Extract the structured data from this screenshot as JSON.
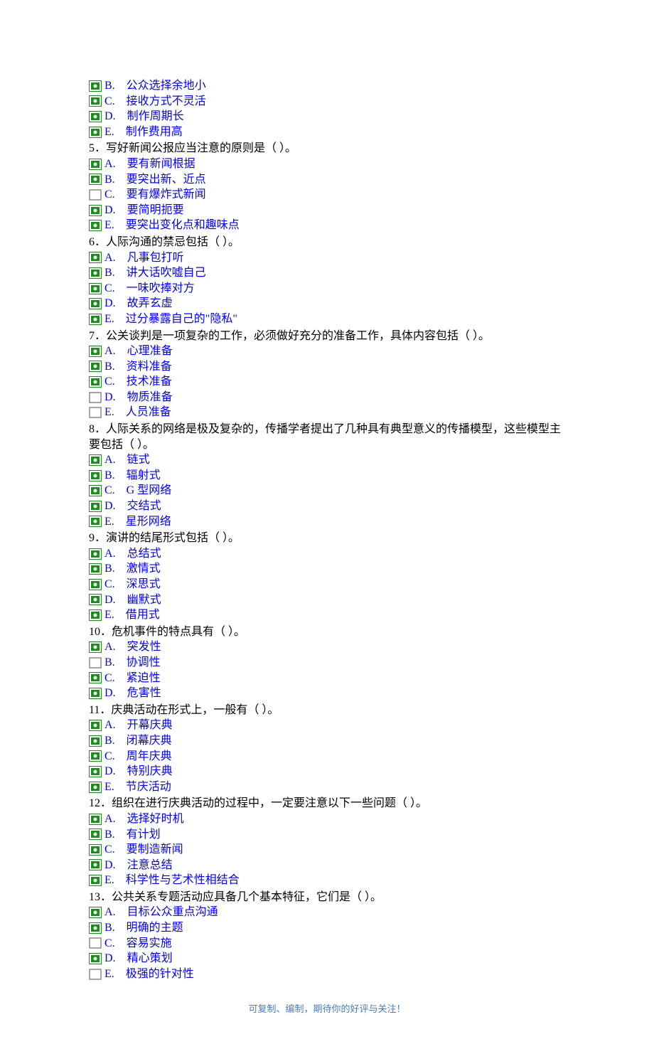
{
  "partial_options": [
    {
      "letter": "B.",
      "text": "公众选择余地小",
      "checked": true
    },
    {
      "letter": "C.",
      "text": "接收方式不灵活",
      "checked": true
    },
    {
      "letter": "D.",
      "text": "制作周期长",
      "checked": true
    },
    {
      "letter": "E.",
      "text": "制作费用高",
      "checked": true
    }
  ],
  "questions": [
    {
      "number": "5．",
      "text": "写好新闻公报应当注意的原则是（ ）。",
      "options": [
        {
          "letter": "A.",
          "text": "要有新闻根据",
          "checked": true
        },
        {
          "letter": "B.",
          "text": "要突出新、近点",
          "checked": true
        },
        {
          "letter": "C.",
          "text": "要有爆炸式新闻",
          "checked": false
        },
        {
          "letter": "D.",
          "text": "要简明扼要",
          "checked": true
        },
        {
          "letter": "E.",
          "text": "要突出变化点和趣味点",
          "checked": true
        }
      ]
    },
    {
      "number": "6．",
      "text": "人际沟通的禁忌包括（ ）。",
      "options": [
        {
          "letter": "A.",
          "text": "凡事包打听",
          "checked": true
        },
        {
          "letter": "B.",
          "text": "讲大话吹嘘自己",
          "checked": true
        },
        {
          "letter": "C.",
          "text": "一味吹捧对方",
          "checked": true
        },
        {
          "letter": "D.",
          "text": "故弄玄虚",
          "checked": true
        },
        {
          "letter": "E.",
          "text": "过分暴露自己的\"隐私\"",
          "checked": true
        }
      ]
    },
    {
      "number": "7．",
      "text": "公关谈判是一项复杂的工作，必须做好充分的准备工作，具体内容包括（ ）。",
      "options": [
        {
          "letter": "A.",
          "text": "心理准备",
          "checked": true
        },
        {
          "letter": "B.",
          "text": "资料准备",
          "checked": true
        },
        {
          "letter": "C.",
          "text": "技术准备",
          "checked": true
        },
        {
          "letter": "D.",
          "text": "物质准备",
          "checked": false
        },
        {
          "letter": "E.",
          "text": "人员准备",
          "checked": false
        }
      ]
    },
    {
      "number": "8．",
      "text": "人际关系的网络是极及复杂的，传播学者提出了几种具有典型意义的传播模型，这些模型主要包括（ ）。",
      "options": [
        {
          "letter": "A.",
          "text": "链式",
          "checked": true
        },
        {
          "letter": "B.",
          "text": "辐射式",
          "checked": true
        },
        {
          "letter": "C.",
          "text": "G 型网络",
          "checked": true
        },
        {
          "letter": "D.",
          "text": "交结式",
          "checked": true
        },
        {
          "letter": "E.",
          "text": "星形网络",
          "checked": true
        }
      ]
    },
    {
      "number": "9．",
      "text": "演讲的结尾形式包括（ ）。",
      "options": [
        {
          "letter": "A.",
          "text": "总结式",
          "checked": true
        },
        {
          "letter": "B.",
          "text": "激情式",
          "checked": true
        },
        {
          "letter": "C.",
          "text": "深思式",
          "checked": true
        },
        {
          "letter": "D.",
          "text": "幽默式",
          "checked": true
        },
        {
          "letter": "E.",
          "text": "借用式",
          "checked": true
        }
      ]
    },
    {
      "number": "10．",
      "text": "危机事件的特点具有（ ）。",
      "options": [
        {
          "letter": "A.",
          "text": "突发性",
          "checked": true
        },
        {
          "letter": "B.",
          "text": "协调性",
          "checked": false
        },
        {
          "letter": "C.",
          "text": "紧迫性",
          "checked": true
        },
        {
          "letter": "D.",
          "text": "危害性",
          "checked": true
        }
      ]
    },
    {
      "number": "11．",
      "text": "庆典活动在形式上，一般有（ ）。",
      "options": [
        {
          "letter": "A.",
          "text": "开幕庆典",
          "checked": true
        },
        {
          "letter": "B.",
          "text": "闭幕庆典",
          "checked": true
        },
        {
          "letter": "C.",
          "text": "周年庆典",
          "checked": true
        },
        {
          "letter": "D.",
          "text": "特别庆典",
          "checked": true
        },
        {
          "letter": "E.",
          "text": "节庆活动",
          "checked": true
        }
      ]
    },
    {
      "number": "12．",
      "text": "组织在进行庆典活动的过程中，一定要注意以下一些问题（ ）。",
      "options": [
        {
          "letter": "A.",
          "text": "选择好时机",
          "checked": true
        },
        {
          "letter": "B.",
          "text": "有计划",
          "checked": true
        },
        {
          "letter": "C.",
          "text": "要制造新闻",
          "checked": true
        },
        {
          "letter": "D.",
          "text": "注意总结",
          "checked": true
        },
        {
          "letter": "E.",
          "text": "科学性与艺术性相结合",
          "checked": true
        }
      ]
    },
    {
      "number": "13．",
      "text": "公共关系专题活动应具备几个基本特征，它们是（ ）。",
      "options": [
        {
          "letter": "A.",
          "text": "目标公众重点沟通",
          "checked": true
        },
        {
          "letter": "B.",
          "text": "明确的主题",
          "checked": true
        },
        {
          "letter": "C.",
          "text": "容易实施",
          "checked": false
        },
        {
          "letter": "D.",
          "text": "精心策划",
          "checked": true
        },
        {
          "letter": "E.",
          "text": "极强的针对性",
          "checked": false
        }
      ]
    }
  ],
  "footer": "可复制、编制，期待你的好评与关注！"
}
